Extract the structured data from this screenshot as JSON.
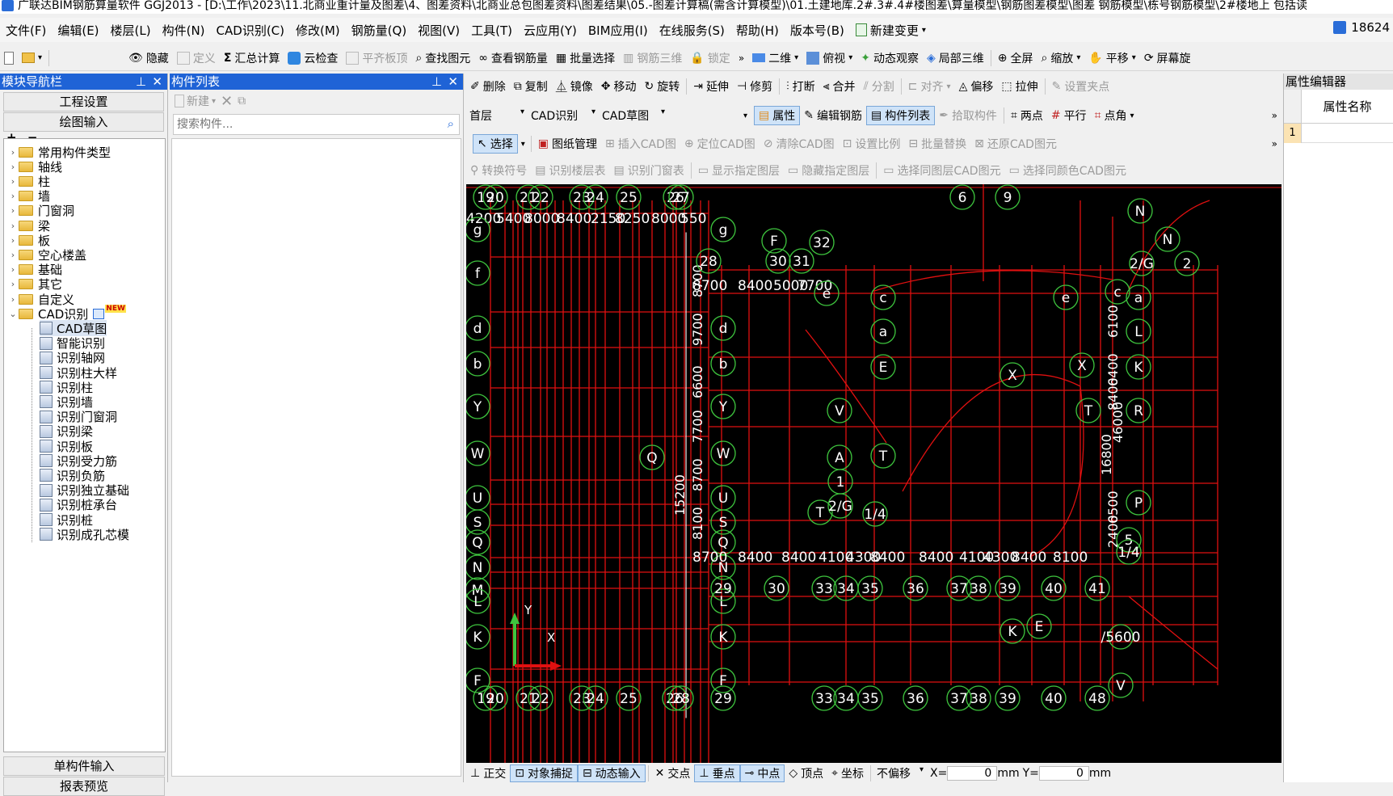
{
  "window": {
    "title": "广联达BIM钢筋算量软件 GGJ2013 - [D:\\工作\\2023\\11.北商业重计量及图差\\4、图差资料\\北商业总包图差资料\\图差结果\\05.-图差计算稿(需含计算模型)\\01.土建地库.2#.3#.4#楼图差\\算量模型\\钢筋图差模型\\图差 钢筋模型\\栋号钢筋模型\\2#楼地上 包括读"
  },
  "menu": [
    "文件(F)",
    "编辑(E)",
    "楼层(L)",
    "构件(N)",
    "CAD识别(C)",
    "修改(M)",
    "钢筋量(Q)",
    "视图(V)",
    "工具(T)",
    "云应用(Y)",
    "BIM应用(I)",
    "在线服务(S)",
    "帮助(H)",
    "版本号(B)",
    "新建变更"
  ],
  "user_id": "18624",
  "toolbar1": [
    "隐藏",
    "定义",
    "汇总计算",
    "云检查",
    "平齐板顶",
    "查找图元",
    "查看钢筋量",
    "批量选择",
    "钢筋三维",
    "锁定",
    "二维",
    "俯视",
    "动态观察",
    "局部三维",
    "全屏",
    "缩放",
    "平移",
    "屏幕旋"
  ],
  "nav": {
    "title": "模块导航栏",
    "btn_project": "工程设置",
    "btn_draw": "绘图输入",
    "tree_folders": [
      "常用构件类型",
      "轴线",
      "柱",
      "墙",
      "门窗洞",
      "梁",
      "板",
      "空心楼盖",
      "基础",
      "其它",
      "自定义"
    ],
    "cad_folder": "CAD识别",
    "new_badge": "NEW",
    "cad_items": [
      "CAD草图",
      "智能识别",
      "识别轴网",
      "识别柱大样",
      "识别柱",
      "识别墙",
      "识别门窗洞",
      "识别梁",
      "识别板",
      "识别受力筋",
      "识别负筋",
      "识别独立基础",
      "识别桩承台",
      "识别桩",
      "识别成孔芯模"
    ],
    "btn_single": "单构件输入",
    "btn_report": "报表预览"
  },
  "complist": {
    "title": "构件列表",
    "new_label": "新建",
    "search_placeholder": "搜索构件..."
  },
  "edit_toolbar": [
    "删除",
    "复制",
    "镜像",
    "移动",
    "旋转",
    "延伸",
    "修剪",
    "打断",
    "合并",
    "分割",
    "对齐",
    "偏移",
    "拉伸",
    "设置夹点"
  ],
  "layer_bar": {
    "floor": "首层",
    "mode": "CAD识别",
    "sub": "CAD草图",
    "empty": "",
    "btn_attr": "属性",
    "btn_edit_rebar": "编辑钢筋",
    "btn_list": "构件列表",
    "btn_pick": "拾取构件",
    "two_point": "两点",
    "parallel": "平行",
    "point_angle": "点角"
  },
  "cad_bar": [
    "选择",
    "图纸管理",
    "插入CAD图",
    "定位CAD图",
    "清除CAD图",
    "设置比例",
    "批量替换",
    "还原CAD图元"
  ],
  "cad_bar2": [
    "转换符号",
    "识别楼层表",
    "识别门窗表",
    "显示指定图层",
    "隐藏指定图层",
    "选择同图层CAD图元",
    "选择同颜色CAD图元"
  ],
  "status_bar": {
    "ortho": "正交",
    "snap": "对象捕捉",
    "dynamic": "动态输入",
    "intersect": "交点",
    "perp": "垂点",
    "mid": "中点",
    "vertex": "顶点",
    "coord": "坐标",
    "offset": "不偏移",
    "x_label": "X=",
    "x_val": "0",
    "mm1": "mm",
    "y_label": "Y=",
    "y_val": "0",
    "mm2": "mm"
  },
  "prop": {
    "title": "属性编辑器",
    "col_name": "属性名称",
    "row1": "1"
  },
  "cad": {
    "top_axes": [
      "19",
      "20",
      "21",
      "22",
      "23",
      "24",
      "25",
      "26",
      "27",
      "6",
      "9"
    ],
    "top_dims": [
      "4200",
      "5400",
      "8000",
      "8400",
      "2150",
      "8250",
      "8000",
      "550"
    ],
    "bottom_axes": [
      "19",
      "20",
      "21",
      "22",
      "23",
      "24",
      "25",
      "26",
      "28",
      "29",
      "33",
      "34",
      "35",
      "36",
      "37",
      "38",
      "39",
      "40",
      "48"
    ],
    "left_axes": [
      "g",
      "f",
      "d",
      "b",
      "Y",
      "W",
      "U",
      "S",
      "Q",
      "N",
      "M",
      "L",
      "K",
      "F"
    ],
    "mid_axes": [
      "g",
      "d",
      "b",
      "Y",
      "W",
      "U",
      "S",
      "Q",
      "N",
      "L",
      "K",
      "F"
    ],
    "row_axes": [
      "29",
      "30",
      "33",
      "34",
      "35",
      "36",
      "37",
      "38",
      "39",
      "40",
      "41"
    ],
    "row_dims": [
      "8700",
      "8400",
      "8400",
      "4100",
      "4300",
      "8400",
      "8400",
      "4100",
      "4300",
      "8400",
      "8100"
    ],
    "upper_dims": [
      "8700",
      "8400",
      "5000",
      "7700"
    ],
    "vert_dims": [
      "8700",
      "9700",
      "6600",
      "7700",
      "8700",
      "8100",
      "15200"
    ],
    "right_dims": [
      "6100",
      "6400",
      "8400",
      "46000",
      "16800",
      "6500",
      "2400"
    ],
    "misc_labels": [
      "F",
      "32",
      "28",
      "30",
      "31",
      "e",
      "c",
      "a",
      "E",
      "X",
      "V",
      "1",
      "A",
      "T",
      "T",
      "2/G",
      "1/4",
      "N",
      "N",
      "2/G",
      "2",
      "e",
      "c",
      "a",
      "L",
      "K",
      "X",
      "T",
      "R",
      "P",
      "5",
      "1/4",
      "K",
      "E",
      "/5600",
      "V",
      "Q"
    ],
    "ucs_y": "Y",
    "ucs_x": "X"
  },
  "colors": {
    "nav_head": "#1f63d6",
    "cad_bg": "#000000",
    "axis_green": "#3ec53e",
    "grid_red": "#e01010",
    "dim_white": "#ffffff"
  }
}
